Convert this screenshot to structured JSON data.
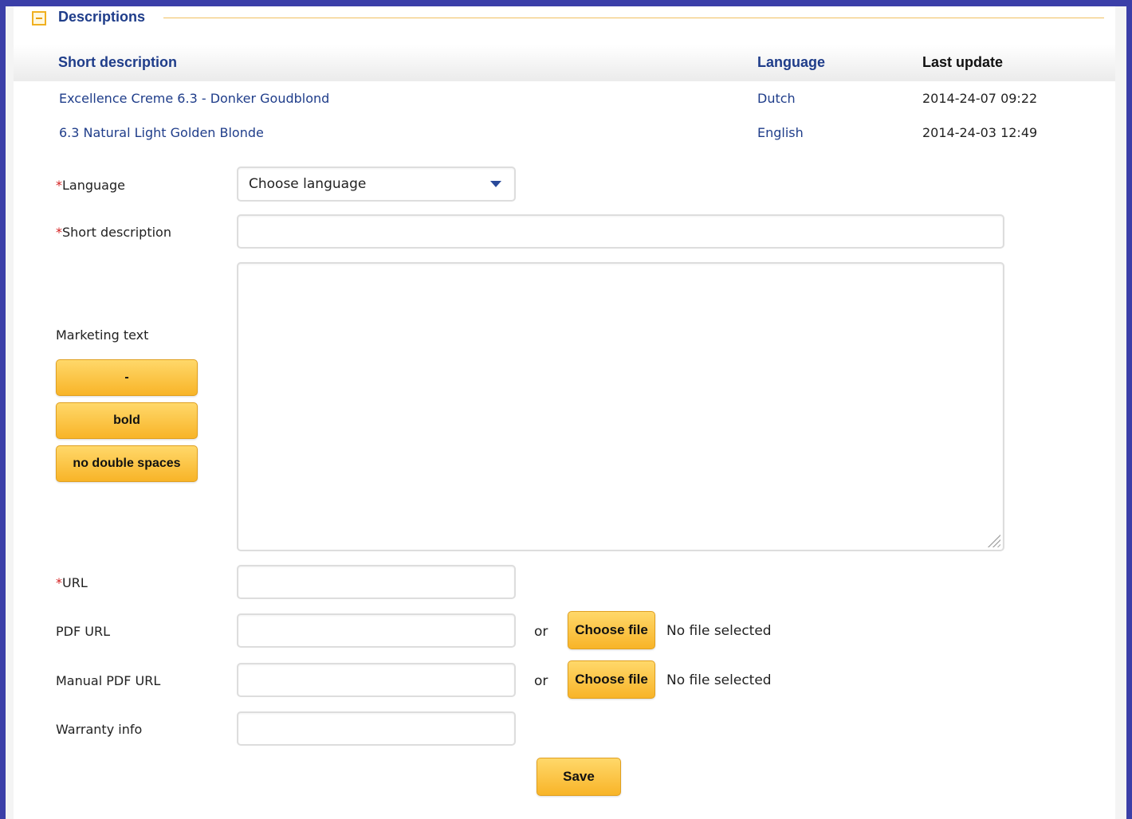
{
  "section": {
    "title": "Descriptions"
  },
  "table": {
    "headers": {
      "short_description": "Short description",
      "language": "Language",
      "last_update": "Last update"
    },
    "rows": [
      {
        "short_description": "Excellence Creme 6.3 - Donker Goudblond",
        "language": "Dutch",
        "last_update": "2014-24-07 09:22"
      },
      {
        "short_description": "6.3 Natural Light Golden Blonde",
        "language": "English",
        "last_update": "2014-24-03 12:49"
      }
    ]
  },
  "form": {
    "required_marker": "*",
    "language": {
      "label": "Language",
      "selected": "Choose language"
    },
    "short_description": {
      "label": "Short description",
      "value": ""
    },
    "marketing_text": {
      "label": "Marketing text",
      "value": ""
    },
    "marketing_buttons": {
      "dash": "-",
      "bold": "bold",
      "no_double_spaces": "no double spaces"
    },
    "url": {
      "label": "URL",
      "value": ""
    },
    "pdf_url": {
      "label": "PDF URL",
      "value": "",
      "or": "or",
      "choose_file": "Choose file",
      "no_file": "No file selected"
    },
    "manual_pdf_url": {
      "label": "Manual PDF URL",
      "value": "",
      "or": "or",
      "choose_file": "Choose file",
      "no_file": "No file selected"
    },
    "warranty_info": {
      "label": "Warranty info",
      "value": ""
    },
    "save": "Save"
  },
  "colors": {
    "link": "#1f3d8a",
    "button": "#f8b428",
    "required": "#d42020",
    "frame": "#3b3fa8"
  }
}
